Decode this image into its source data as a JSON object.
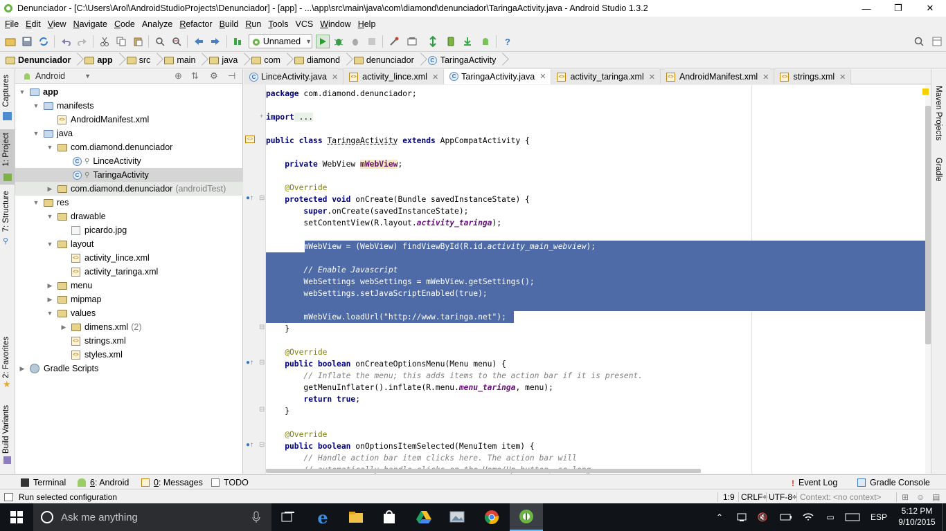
{
  "window": {
    "title": "Denunciador - [C:\\Users\\Arol\\AndroidStudioProjects\\Denunciador] - [app] - ...\\app\\src\\main\\java\\com\\diamond\\denunciador\\TaringaActivity.java - Android Studio 1.3.2",
    "minimize": "—",
    "restore": "❐",
    "close": "✕"
  },
  "menu": [
    {
      "label": "File",
      "u": "F",
      "rest": "ile"
    },
    {
      "label": "Edit",
      "u": "E",
      "rest": "dit"
    },
    {
      "label": "View",
      "u": "V",
      "rest": "iew"
    },
    {
      "label": "Navigate",
      "u": "N",
      "rest": "avigate"
    },
    {
      "label": "Code",
      "u": "C",
      "rest": "ode"
    },
    {
      "label": "Analyze",
      "u": "",
      "rest": "Analyze"
    },
    {
      "label": "Refactor",
      "u": "R",
      "rest": "efactor"
    },
    {
      "label": "Build",
      "u": "B",
      "rest": "uild"
    },
    {
      "label": "Run",
      "u": "R",
      "rest": "un"
    },
    {
      "label": "Tools",
      "u": "T",
      "rest": "ools"
    },
    {
      "label": "VCS",
      "u": "",
      "rest": "VCS"
    },
    {
      "label": "Window",
      "u": "W",
      "rest": "indow"
    },
    {
      "label": "Help",
      "u": "H",
      "rest": "elp"
    }
  ],
  "toolbar": {
    "run_config": "Unnamed",
    "help_label": "?"
  },
  "breadcrumbs": [
    "Denunciador",
    "app",
    "src",
    "main",
    "java",
    "com",
    "diamond",
    "denunciador",
    "TaringaActivity"
  ],
  "left_tools": {
    "captures": "Captures",
    "project": "1: Project",
    "structure": "7: Structure",
    "favorites": "2: Favorites",
    "build_variants": "Build Variants"
  },
  "right_tools": {
    "maven": "Maven Projects",
    "gradle": "Gradle"
  },
  "project_panel": {
    "view_mode": "Android",
    "tree": [
      {
        "label": "app",
        "extra": "",
        "bold": true
      },
      {
        "label": "manifests",
        "extra": ""
      },
      {
        "label": "AndroidManifest.xml",
        "extra": ""
      },
      {
        "label": "java",
        "extra": ""
      },
      {
        "label": "com.diamond.denunciador",
        "extra": ""
      },
      {
        "label": "LinceActivity",
        "extra": ""
      },
      {
        "label": "TaringaActivity",
        "extra": ""
      },
      {
        "label": "com.diamond.denunciador",
        "extra": "(androidTest)"
      },
      {
        "label": "res",
        "extra": ""
      },
      {
        "label": "drawable",
        "extra": ""
      },
      {
        "label": "picardo.jpg",
        "extra": ""
      },
      {
        "label": "layout",
        "extra": ""
      },
      {
        "label": "activity_lince.xml",
        "extra": ""
      },
      {
        "label": "activity_taringa.xml",
        "extra": ""
      },
      {
        "label": "menu",
        "extra": ""
      },
      {
        "label": "mipmap",
        "extra": ""
      },
      {
        "label": "values",
        "extra": ""
      },
      {
        "label": "dimens.xml",
        "extra": "(2)"
      },
      {
        "label": "strings.xml",
        "extra": ""
      },
      {
        "label": "styles.xml",
        "extra": ""
      },
      {
        "label": "Gradle Scripts",
        "extra": ""
      }
    ]
  },
  "editor_tabs": [
    {
      "label": "LinceActivity.java",
      "active": false
    },
    {
      "label": "activity_lince.xml",
      "active": false
    },
    {
      "label": "TaringaActivity.java",
      "active": true
    },
    {
      "label": "activity_taringa.xml",
      "active": false
    },
    {
      "label": "AndroidManifest.xml",
      "active": false
    },
    {
      "label": "strings.xml",
      "active": false
    }
  ],
  "code": {
    "l1_a": "package",
    "l1_b": " com.diamond.denunciador;",
    "l2_a": "import",
    "l2_b": " ...",
    "l3_a": "public class ",
    "l3_b": "TaringaActivity",
    "l3_c": " extends ",
    "l3_d": "AppCompatActivity {",
    "l4_a": "    private ",
    "l4_b": "WebView ",
    "l4_c": "mWebView",
    "l4_d": ";",
    "l5": "    @Override",
    "l6_a": "    protected void ",
    "l6_b": "onCreate(Bundle savedInstanceState) {",
    "l7_a": "        super",
    "l7_b": ".onCreate(savedInstanceState);",
    "l8_a": "        setContentView(R.layout.",
    "l8_b": "activity_taringa",
    "l8_c": ");",
    "l9_a": "        mWebView = (WebView) findViewById(R.id.",
    "l9_b": "activity_main_webview",
    "l9_c": ");",
    "l10": "        // Enable Javascript",
    "l11": "        WebSettings webSettings = mWebView.getSettings();",
    "l12_a": "        webSettings.setJavaScriptEnabled(",
    "l12_b": "true",
    "l12_c": ");",
    "l13_a": "        mWebView.loadUrl(",
    "l13_b": "\"http://www.taringa.net\"",
    "l13_c": ");",
    "l14": "    }",
    "l15": "    @Override",
    "l16_a": "    public boolean ",
    "l16_b": "onCreateOptionsMenu(Menu menu) {",
    "l17": "        // Inflate the menu; this adds items to the action bar if it is present.",
    "l18_a": "        getMenuInflater().inflate(R.menu.",
    "l18_b": "menu_taringa",
    "l18_c": ", menu);",
    "l19_a": "        return true",
    "l19_b": ";",
    "l20": "    }",
    "l21": "    @Override",
    "l22_a": "    public boolean ",
    "l22_b": "onOptionsItemSelected(MenuItem item) {",
    "l23": "        // Handle action bar item clicks here. The action bar will",
    "l24": "        // automatically handle clicks on the Home/Up button, so long"
  },
  "bottom_tools": {
    "terminal": "Terminal",
    "android_num": "6",
    "android": ": Android",
    "messages_num": "0",
    "messages": ": Messages",
    "todo": "TODO",
    "event_log": "Event Log",
    "gradle_console": "Gradle Console"
  },
  "status": {
    "message": "Run selected configuration",
    "position": "1:9",
    "line_sep": "CRLF÷",
    "encoding": "UTF-8÷",
    "context": "Context: <no context>"
  },
  "taskbar": {
    "search_placeholder": "Ask me anything",
    "time": "5:12 PM",
    "date": "9/10/2015",
    "lang": "ESP"
  },
  "colors": {
    "selection": "#4e6ba8",
    "keyword": "#000080",
    "annotation": "#808000",
    "field": "#660e7a",
    "string": "#008000",
    "taskbar": "#101317"
  }
}
